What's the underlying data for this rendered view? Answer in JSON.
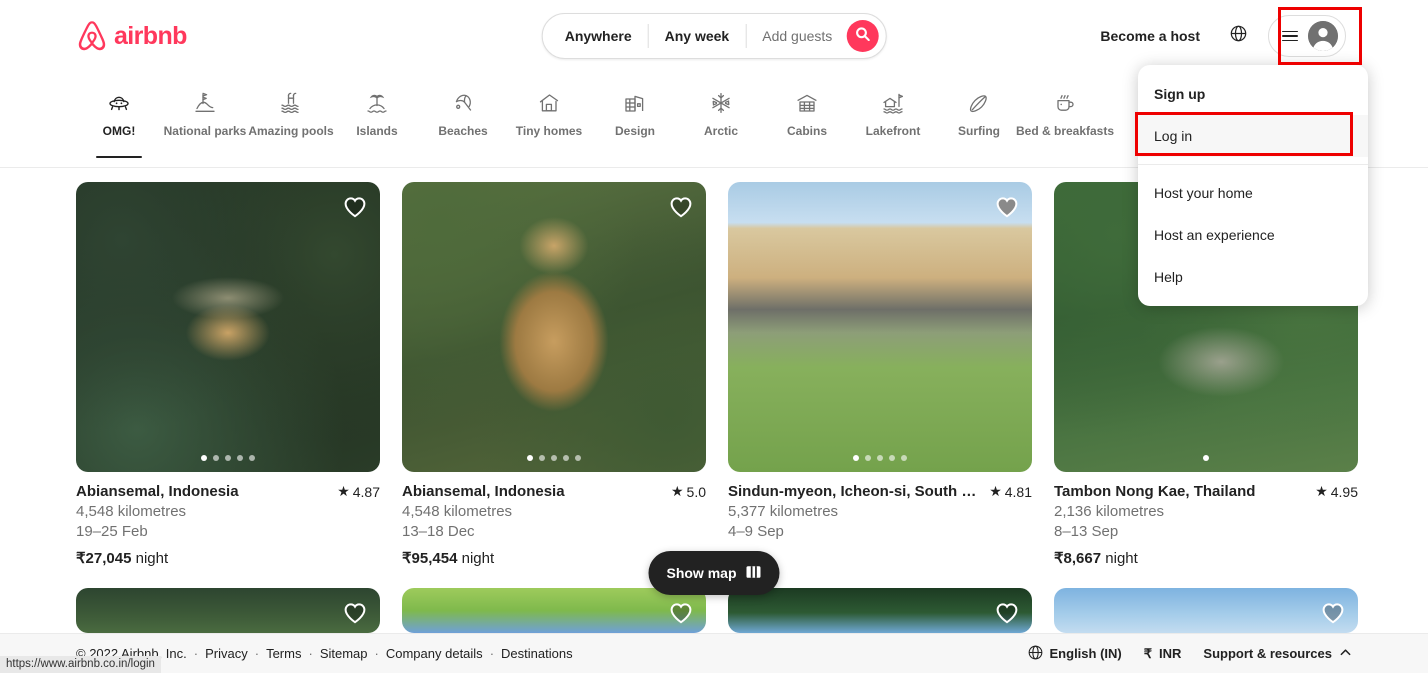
{
  "brand": {
    "name": "airbnb",
    "color": "#FF385C",
    "logo_icon": "airbnb-logo-icon"
  },
  "search": {
    "where": "Anywhere",
    "when": "Any week",
    "guests": "Add guests",
    "search_icon": "search-icon"
  },
  "header": {
    "become_host": "Become a host",
    "globe_icon": "globe-icon",
    "menu_icon": "hamburger-icon",
    "avatar_icon": "user-avatar-icon"
  },
  "dropdown": {
    "items": [
      {
        "label": "Sign up",
        "bold": true,
        "active": false
      },
      {
        "label": "Log in",
        "bold": false,
        "active": true
      },
      {
        "label": "Host your home",
        "bold": false,
        "active": false
      },
      {
        "label": "Host an experience",
        "bold": false,
        "active": false
      },
      {
        "label": "Help",
        "bold": false,
        "active": false
      }
    ]
  },
  "highlight_color": "#EE0000",
  "categories": [
    {
      "label": "OMG!",
      "icon": "ufo-icon",
      "active": true
    },
    {
      "label": "National parks",
      "icon": "national-park-icon",
      "active": false
    },
    {
      "label": "Amazing pools",
      "icon": "pool-icon",
      "active": false
    },
    {
      "label": "Islands",
      "icon": "island-icon",
      "active": false
    },
    {
      "label": "Beaches",
      "icon": "beach-umbrella-icon",
      "active": false
    },
    {
      "label": "Tiny homes",
      "icon": "tiny-home-icon",
      "active": false
    },
    {
      "label": "Design",
      "icon": "design-building-icon",
      "active": false
    },
    {
      "label": "Arctic",
      "icon": "snowflake-icon",
      "active": false
    },
    {
      "label": "Cabins",
      "icon": "cabin-icon",
      "active": false
    },
    {
      "label": "Lakefront",
      "icon": "lakefront-icon",
      "active": false
    },
    {
      "label": "Surfing",
      "icon": "surfboard-icon",
      "active": false
    },
    {
      "label": "Bed & breakfasts",
      "icon": "coffee-cup-icon",
      "active": false
    }
  ],
  "listings": [
    {
      "title": "Abiansemal, Indonesia",
      "rating": "4.87",
      "distance": "4,548 kilometres",
      "dates": "19–25 Feb",
      "price": "₹27,045",
      "price_unit": "night",
      "favorited": false,
      "dots": 5,
      "active_dot": 0
    },
    {
      "title": "Abiansemal, Indonesia",
      "rating": "5.0",
      "distance": "4,548 kilometres",
      "dates": "13–18 Dec",
      "price": "₹95,454",
      "price_unit": "night",
      "favorited": false,
      "dots": 5,
      "active_dot": 0
    },
    {
      "title": "Sindun-myeon, Icheon-si, South Korea",
      "rating": "4.81",
      "distance": "5,377 kilometres",
      "dates": "4–9 Sep",
      "price": "",
      "price_unit": "night",
      "favorited": true,
      "dots": 5,
      "active_dot": 0
    },
    {
      "title": "Tambon Nong Kae, Thailand",
      "rating": "4.95",
      "distance": "2,136 kilometres",
      "dates": "8–13 Sep",
      "price": "₹8,667",
      "price_unit": "night",
      "favorited": false,
      "dots": 1,
      "active_dot": 0
    }
  ],
  "show_map": {
    "label": "Show map",
    "icon": "map-icon"
  },
  "footer": {
    "copyright": "© 2022 Airbnb, Inc.",
    "links": [
      "Privacy",
      "Terms",
      "Sitemap",
      "Company details",
      "Destinations"
    ],
    "language": "English (IN)",
    "language_icon": "globe-icon",
    "currency": "INR",
    "currency_symbol": "₹",
    "support": "Support & resources",
    "support_icon": "chevron-up-icon"
  },
  "status_bar": {
    "url": "https://www.airbnb.co.in/login"
  }
}
